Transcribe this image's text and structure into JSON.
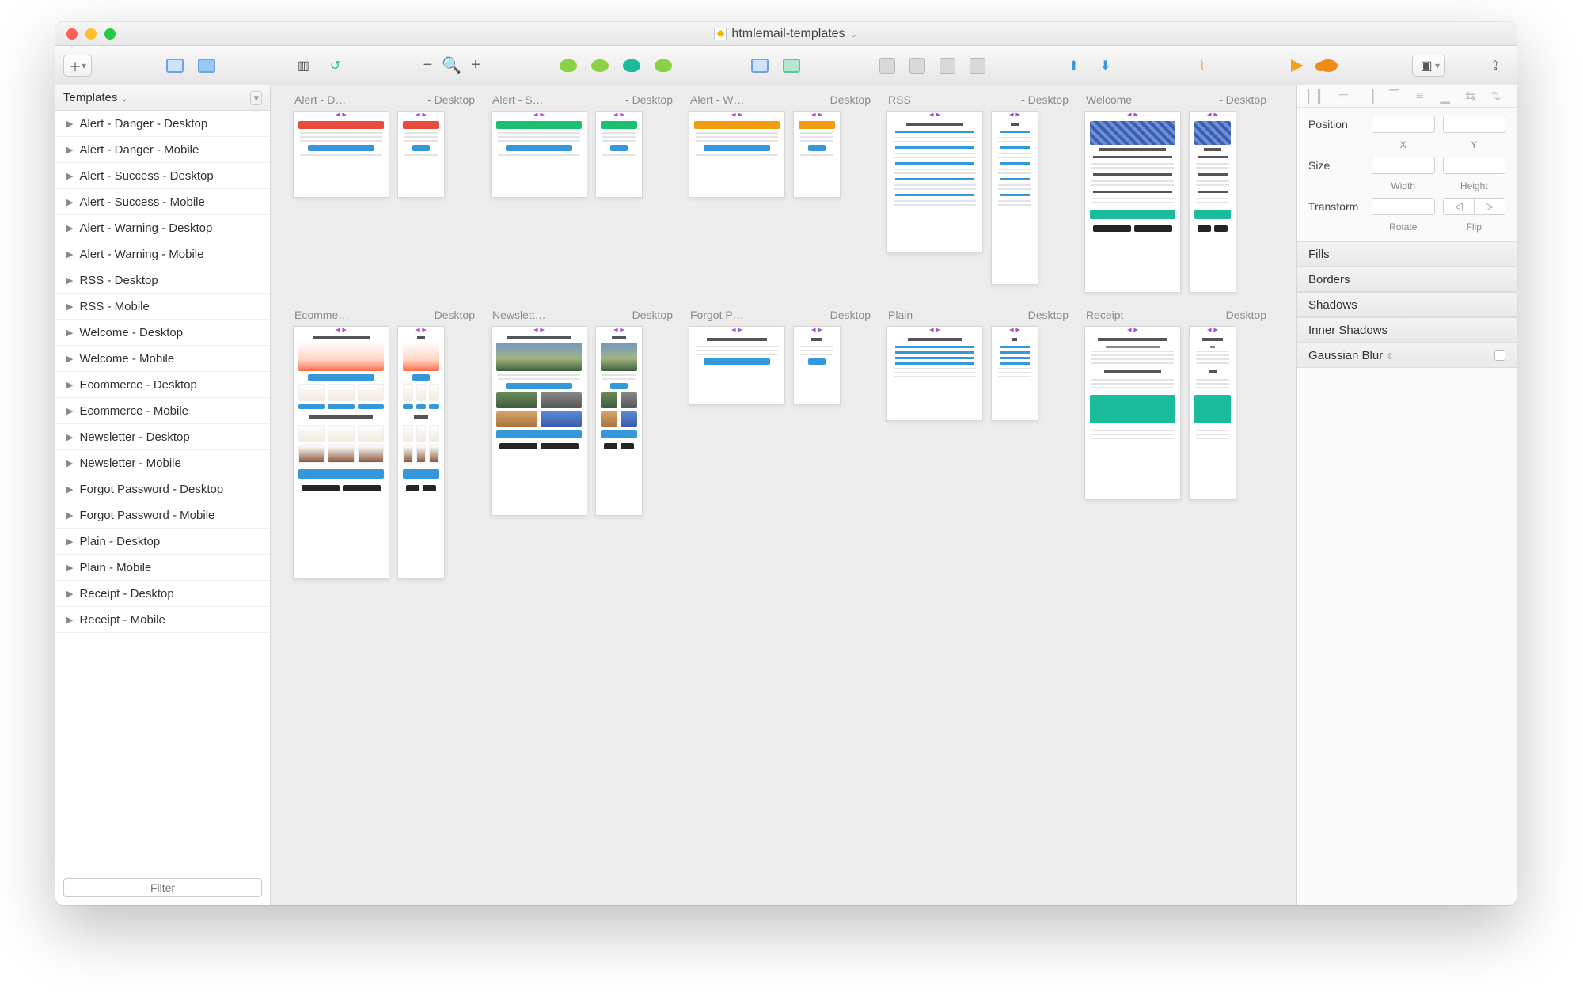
{
  "window": {
    "title": "htmlemail-templates"
  },
  "toolbar": {
    "zoom_minus": "−",
    "zoom_plus": "+"
  },
  "sidebar": {
    "header": "Templates",
    "items": [
      "Alert - Danger - Desktop",
      "Alert - Danger - Mobile",
      "Alert - Success - Desktop",
      "Alert - Success - Mobile",
      "Alert - Warning - Desktop",
      "Alert - Warning - Mobile",
      "RSS - Desktop",
      "RSS - Mobile",
      "Welcome - Desktop",
      "Welcome - Mobile",
      "Ecommerce - Desktop",
      "Ecommerce - Mobile",
      "Newsletter - Desktop",
      "Newsletter - Mobile",
      "Forgot Password - Desktop",
      "Forgot Password - Mobile",
      "Plain - Desktop",
      "Plain - Mobile",
      "Receipt - Desktop",
      "Receipt - Mobile"
    ],
    "filter_placeholder": "Filter"
  },
  "canvas": {
    "artboards": [
      {
        "left": "Alert - D…",
        "right": "- Desktop",
        "accent": "accent-red",
        "h1": 110,
        "h2": 110,
        "kind": "alert"
      },
      {
        "left": "Alert - S…",
        "right": "- Desktop",
        "accent": "accent-green",
        "h1": 110,
        "h2": 110,
        "kind": "alert"
      },
      {
        "left": "Alert - W…",
        "right": "Desktop",
        "accent": "accent-orange",
        "h1": 110,
        "h2": 110,
        "kind": "alert"
      },
      {
        "left": "RSS",
        "right": "- Desktop",
        "accent": "accent-blue",
        "h1": 180,
        "h2": 220,
        "kind": "rss"
      },
      {
        "left": "Welcome",
        "right": "- Desktop",
        "accent": "accent-teal",
        "h1": 230,
        "h2": 230,
        "kind": "welcome"
      },
      {
        "left": "Ecomme…",
        "right": "- Desktop",
        "accent": "accent-blue",
        "h1": 320,
        "h2": 320,
        "kind": "ecom"
      },
      {
        "left": "Newslett…",
        "right": "Desktop",
        "accent": "accent-blue",
        "h1": 240,
        "h2": 240,
        "kind": "newsletter"
      },
      {
        "left": "Forgot P…",
        "right": "- Desktop",
        "accent": "accent-blue",
        "h1": 100,
        "h2": 100,
        "kind": "forgot"
      },
      {
        "left": "Plain",
        "right": "- Desktop",
        "accent": "accent-blue",
        "h1": 120,
        "h2": 120,
        "kind": "plain"
      },
      {
        "left": "Receipt",
        "right": "- Desktop",
        "accent": "accent-teal",
        "h1": 220,
        "h2": 220,
        "kind": "receipt"
      }
    ]
  },
  "inspector": {
    "position_label": "Position",
    "position_x": "X",
    "position_y": "Y",
    "size_label": "Size",
    "size_w": "Width",
    "size_h": "Height",
    "transform_label": "Transform",
    "rotate": "Rotate",
    "flip": "Flip",
    "sections": [
      "Fills",
      "Borders",
      "Shadows",
      "Inner Shadows",
      "Gaussian Blur"
    ]
  }
}
